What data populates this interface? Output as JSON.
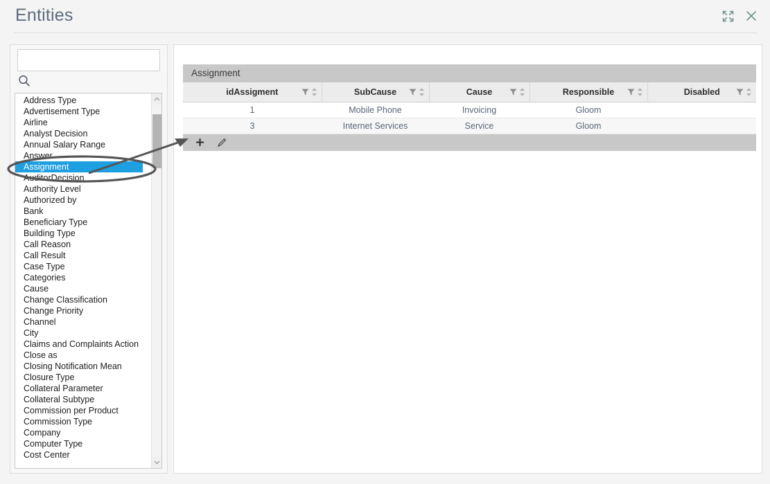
{
  "header": {
    "title": "Entities",
    "expand_icon": "expand-icon",
    "close_icon": "close-icon"
  },
  "sidebar": {
    "search": {
      "value": "",
      "placeholder": ""
    },
    "search_icon": "search-icon",
    "selected_item": "Assignment",
    "items": [
      "Address Type",
      "Advertisement Type",
      "Airline",
      "Analyst Decision",
      "Annual Salary Range",
      "Answer",
      "Assignment",
      "AuditorDecision",
      "Authority Level",
      "Authorized by",
      "Bank",
      "Beneficiary Type",
      "Building Type",
      "Call Reason",
      "Call Result",
      "Case Type",
      "Categories",
      "Cause",
      "Change Classification",
      "Change Priority",
      "Channel",
      "City",
      "Claims and Complaints Action",
      "Close as",
      "Closing Notification Mean",
      "Closure Type",
      "Collateral Parameter",
      "Collateral Subtype",
      "Commission per Product",
      "Commission Type",
      "Company",
      "Computer Type",
      "Cost Center"
    ]
  },
  "grid": {
    "caption": "Assignment",
    "columns": [
      {
        "label": "idAssigment",
        "filter_icon": "filter-icon",
        "sort_icon": "sort-icon"
      },
      {
        "label": "SubCause",
        "filter_icon": "filter-icon",
        "sort_icon": "sort-icon"
      },
      {
        "label": "Cause",
        "filter_icon": "filter-icon",
        "sort_icon": "sort-icon"
      },
      {
        "label": "Responsible",
        "filter_icon": "filter-icon",
        "sort_icon": "sort-icon"
      },
      {
        "label": "Disabled",
        "filter_icon": "filter-icon",
        "sort_icon": "sort-icon"
      }
    ],
    "rows": [
      {
        "idAssigment": "1",
        "SubCause": "Mobile Phone",
        "Cause": "Invoicing",
        "Responsible": "Gloom",
        "Disabled": ""
      },
      {
        "idAssigment": "3",
        "SubCause": "Internet Services",
        "Cause": "Service",
        "Responsible": "Gloom",
        "Disabled": ""
      }
    ],
    "footer": {
      "add_icon": "plus-icon",
      "edit_icon": "pencil-icon"
    }
  },
  "colors": {
    "selection": "#1e9fe0",
    "title": "#5d6b7d",
    "caption_bar": "#c8c8c8",
    "annotation": "#555555"
  }
}
